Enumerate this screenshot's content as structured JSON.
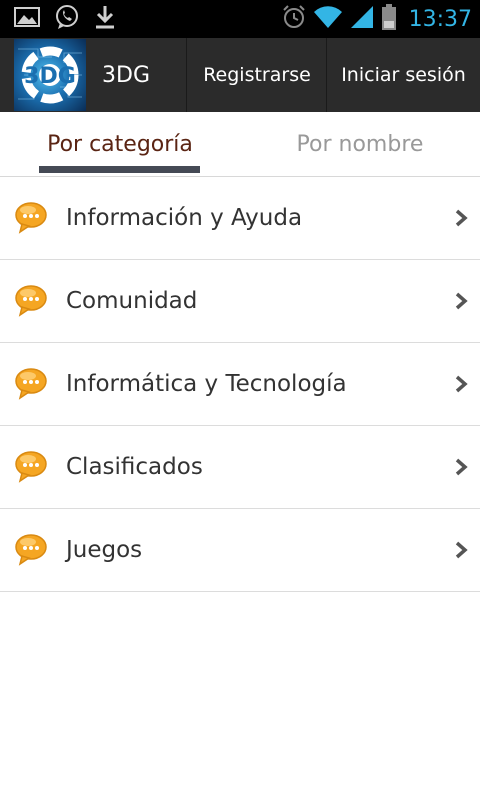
{
  "status_bar": {
    "time": "13:37",
    "left_icons": [
      "image-icon",
      "whatsapp-icon",
      "download-icon"
    ],
    "right_icons": [
      "alarm-icon",
      "wifi-icon",
      "signal-icon",
      "battery-icon"
    ],
    "time_color": "#33b5e5"
  },
  "action_bar": {
    "logo_text": "3DG",
    "title": "3DG",
    "register_label": "Registrarse",
    "login_label": "Iniciar sesión",
    "background": "#2b2b2b"
  },
  "tabs": [
    {
      "label": "Por categoría",
      "selected": true
    },
    {
      "label": "Por nombre",
      "selected": false
    }
  ],
  "categories": [
    {
      "label": "Información y Ayuda",
      "icon": "chat-bubble-icon"
    },
    {
      "label": "Comunidad",
      "icon": "chat-bubble-icon"
    },
    {
      "label": "Informática y Tecnología",
      "icon": "chat-bubble-icon"
    },
    {
      "label": "Clasificados",
      "icon": "chat-bubble-icon"
    },
    {
      "label": "Juegos",
      "icon": "chat-bubble-icon"
    }
  ],
  "colors": {
    "selected_tab_text": "#5a2413",
    "unselected_tab_text": "#999999",
    "tab_indicator": "#454a55",
    "icon_orange": "#f5a623"
  }
}
